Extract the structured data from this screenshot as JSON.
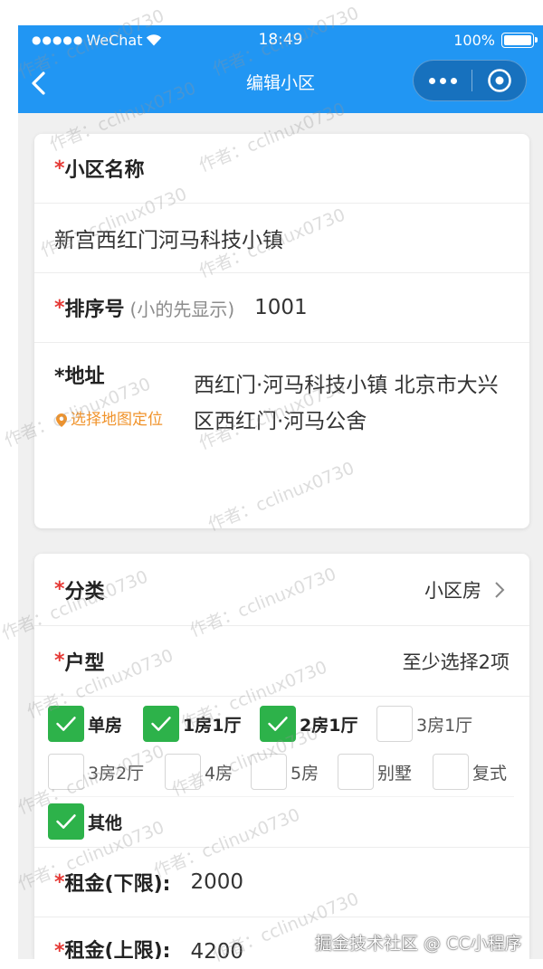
{
  "status_bar": {
    "signal": "●●●●●",
    "carrier": "WeChat",
    "time": "18:49",
    "battery": "100%",
    "icons": [
      "wifi-icon",
      "battery-icon"
    ]
  },
  "nav": {
    "title": "编辑小区",
    "back_icon": "chevron-left-icon",
    "capsule_icons": [
      "more-dots-icon",
      "target-circle-icon"
    ]
  },
  "form": {
    "required_mark": "*",
    "community_name": {
      "label": "小区名称",
      "value": "新宫西红门河马科技小镇"
    },
    "sort_order": {
      "label": "排序号",
      "hint": "(小的先显示)",
      "value": "1001"
    },
    "address": {
      "label": "地址",
      "locate_label": "选择地图定位",
      "locate_icon": "location-pin-icon",
      "value": "西红门·河马科技小镇 北京市大兴区西红门·河马公舍"
    },
    "category": {
      "label": "分类",
      "value": "小区房",
      "icon": "chevron-right-icon"
    },
    "room_type": {
      "label": "户型",
      "hint": "至少选择2项",
      "options": [
        {
          "label": "单房",
          "checked": true
        },
        {
          "label": "1房1厅",
          "checked": true
        },
        {
          "label": "2房1厅",
          "checked": true
        },
        {
          "label": "3房1厅",
          "checked": false
        },
        {
          "label": "3房2厅",
          "checked": false
        },
        {
          "label": "4房",
          "checked": false
        },
        {
          "label": "5房",
          "checked": false
        },
        {
          "label": "别墅",
          "checked": false
        },
        {
          "label": "复式",
          "checked": false
        },
        {
          "label": "其他",
          "checked": true
        }
      ]
    },
    "rent_min": {
      "label": "租金(下限):",
      "value": "2000"
    },
    "rent_max": {
      "label": "租金(上限):",
      "value": "4200"
    }
  },
  "watermark": {
    "text": "作者：cclinux0730",
    "credit": "掘金技术社区 @ CC小程序"
  },
  "colors": {
    "nav_blue": "#2196f3",
    "required_red": "#e53935",
    "locate_orange": "#f0932b",
    "checkbox_green": "#2db24a",
    "page_bg": "#f0f0f0"
  }
}
